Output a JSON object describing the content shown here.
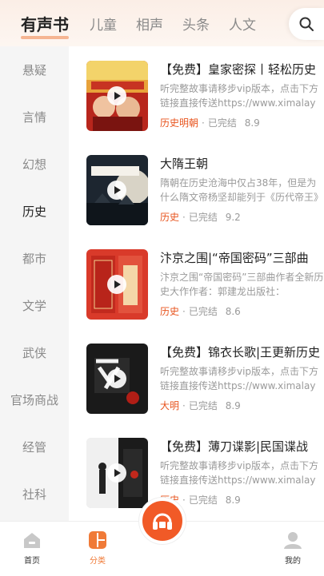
{
  "header": {
    "tabs": [
      {
        "label": "有声书",
        "active": true
      },
      {
        "label": "儿童",
        "active": false
      },
      {
        "label": "相声",
        "active": false
      },
      {
        "label": "头条",
        "active": false
      },
      {
        "label": "人文",
        "active": false
      }
    ],
    "search_icon": "search-icon"
  },
  "sidebar": {
    "items": [
      {
        "label": "悬疑"
      },
      {
        "label": "言情"
      },
      {
        "label": "幻想"
      },
      {
        "label": "历史",
        "active": true
      },
      {
        "label": "都市"
      },
      {
        "label": "文学"
      },
      {
        "label": "武侠"
      },
      {
        "label": "官场商战"
      },
      {
        "label": "经管"
      },
      {
        "label": "社科"
      }
    ]
  },
  "books": [
    {
      "title": "【免费】皇家密探丨轻松历史",
      "desc": "听完整故事请移步vip版本，点击下方链接直接传送https://www.ximalaya.com",
      "tag": "历史明朝",
      "status": "已完结",
      "score": "8.9"
    },
    {
      "title": "大隋王朝",
      "desc": "隋朝在历史沧海中仅占38年，但是为什么隋文帝杨坚却能列于《历代帝王》",
      "tag": "历史",
      "status": "已完结",
      "score": "9.2"
    },
    {
      "title": "汴京之围|“帝国密码”三部曲",
      "desc": "汴京之围“帝国密码”三部曲作者全新历史大作作者：郭建龙出版社：",
      "tag": "历史",
      "status": "已完结",
      "score": "8.6"
    },
    {
      "title": "【免费】锦衣长歌|王更新历史",
      "desc": "听完整故事请移步vip版本，点击下方链接直接传送https://www.ximalaya.com",
      "tag": "大明",
      "status": "已完结",
      "score": "8.9"
    },
    {
      "title": "【免费】薄刀谍影|民国谍战",
      "desc": "听完整故事请移步vip版本，点击下方链接直接传送https://www.ximalaya.com",
      "tag": "历史",
      "status": "已完结",
      "score": "8.9"
    }
  ],
  "bottom_nav": {
    "home": "首页",
    "category": "分类",
    "mine": "我的"
  },
  "colors": {
    "accent": "#f15a27",
    "tag": "#e8541e",
    "active_nav": "#f07a37"
  }
}
